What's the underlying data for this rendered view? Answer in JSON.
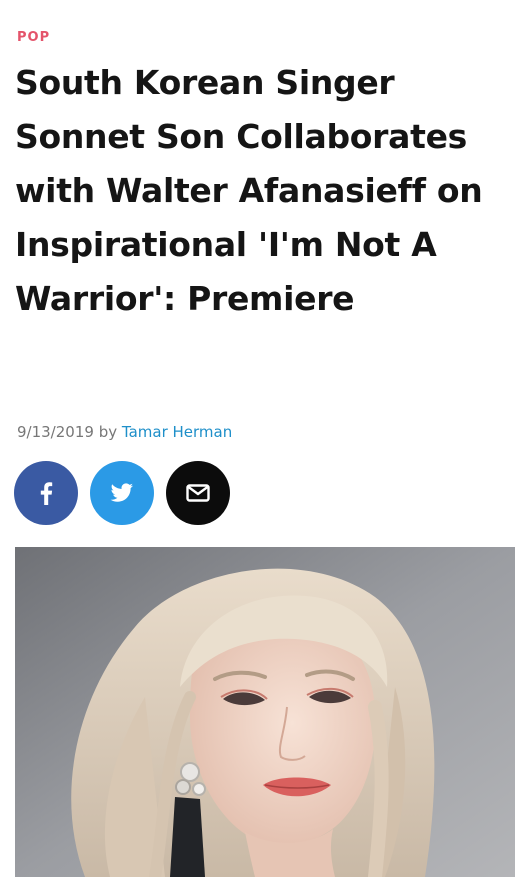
{
  "article": {
    "category": "POP",
    "title": "South Korean Singer Sonnet Son Collaborates with Walter Afanasieff on Inspirational 'I'm Not A Warrior': Premiere",
    "date": "9/13/2019",
    "by_word": "by",
    "author": "Tamar Herman"
  },
  "share": {
    "buttons": [
      {
        "icon": "facebook-icon",
        "color": "#3a5aa3"
      },
      {
        "icon": "twitter-icon",
        "color": "#2b9ae6"
      },
      {
        "icon": "envelope-icon",
        "color": "#0c0c0c"
      }
    ]
  },
  "colors": {
    "category": "#e4546b",
    "author_link": "#1e8fc9",
    "headline": "#151515"
  }
}
